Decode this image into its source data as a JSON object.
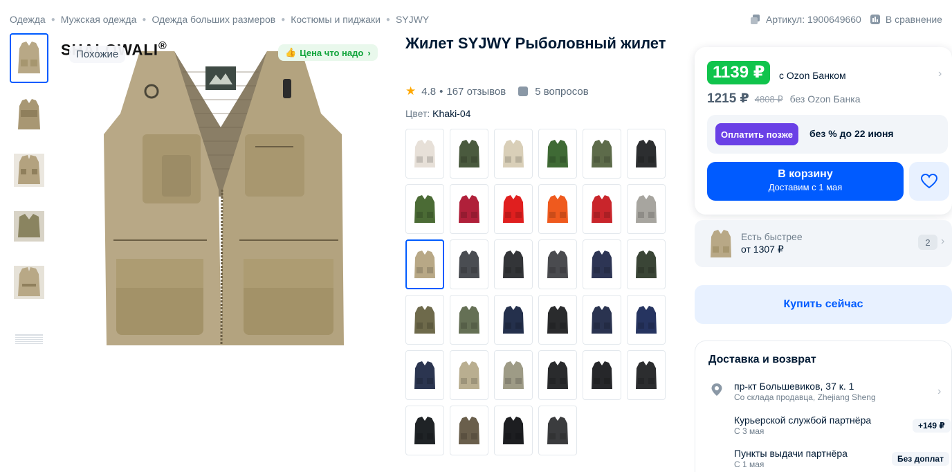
{
  "breadcrumb": [
    "Одежда",
    "Мужская одежда",
    "Одежда больших размеров",
    "Костюмы и пиджаки",
    "SYJWY"
  ],
  "header_right": {
    "article": "Артикул: 1900649660",
    "compare": "В сравнение"
  },
  "gallery": {
    "brand_logo": "SHALOWALI",
    "similar_label": "Похожие",
    "price_badge": "Цена что надо",
    "thumb_count": 6
  },
  "product": {
    "title": "Жилет SYJWY Рыболовный жилет",
    "rating": "4.8",
    "reviews": "167 отзывов",
    "questions": "5 вопросов",
    "color_label": "Цвет:",
    "color_value": "Khaki-04"
  },
  "variants": [
    {
      "color": "#e7e0d8"
    },
    {
      "color": "#4a5a3e"
    },
    {
      "color": "#d9cfb8"
    },
    {
      "color": "#3f6a35"
    },
    {
      "color": "#5d6b4a"
    },
    {
      "color": "#2c2e30"
    },
    {
      "color": "#4b6b35"
    },
    {
      "color": "#b0203a"
    },
    {
      "color": "#e01f1f"
    },
    {
      "color": "#ef5a1e"
    },
    {
      "color": "#c9252b"
    },
    {
      "color": "#a7a59f"
    },
    {
      "color": "#b8a886"
    },
    {
      "color": "#4a4d52"
    },
    {
      "color": "#333538"
    },
    {
      "color": "#4a4b4f"
    },
    {
      "color": "#2d3554"
    },
    {
      "color": "#3a4536"
    },
    {
      "color": "#6e6a4b"
    },
    {
      "color": "#657055"
    },
    {
      "color": "#24304c"
    },
    {
      "color": "#2a2b2d"
    },
    {
      "color": "#2a3350"
    },
    {
      "color": "#263460"
    },
    {
      "color": "#2b3550"
    },
    {
      "color": "#b9ae90"
    },
    {
      "color": "#9e9b86"
    },
    {
      "color": "#2a2b2d"
    },
    {
      "color": "#26272a"
    },
    {
      "color": "#2c2d2f"
    },
    {
      "color": "#1f2326"
    },
    {
      "color": "#6a5f4c"
    },
    {
      "color": "#1d1e21"
    },
    {
      "color": "#3b3c3e"
    }
  ],
  "selected_variant_index": 12,
  "buy": {
    "price_ozon": "1139 ₽",
    "price_ozon_label": "с Ozon Банком",
    "price_regular": "1215 ₽",
    "price_old": "4808 ₽",
    "price_regular_label": "без Ozon Банка",
    "pay_later_button": "Оплатить позже",
    "pay_later_text": "без % до 22 июня",
    "cart_label": "В корзину",
    "cart_sub": "Доставим с 1 мая"
  },
  "faster": {
    "label": "Есть быстрее",
    "price": "от 1307 ₽",
    "count": "2"
  },
  "buy_now": "Купить сейчас",
  "delivery": {
    "title": "Доставка и возврат",
    "address": "пр-кт Большевиков, 37 к. 1",
    "address_sub": "Со склада продавца, Zhejiang Sheng",
    "courier": "Курьерской службой партнёра",
    "courier_sub": "С 3 мая",
    "courier_price": "+149 ₽",
    "pickup": "Пункты выдачи партнёра",
    "pickup_sub": "С 1 мая",
    "pickup_price": "Без доплат"
  },
  "colors": {
    "accent": "#005bff",
    "green_price": "#10c44c",
    "pay_later": "#6a40e6",
    "khaki": "#b8a886"
  }
}
